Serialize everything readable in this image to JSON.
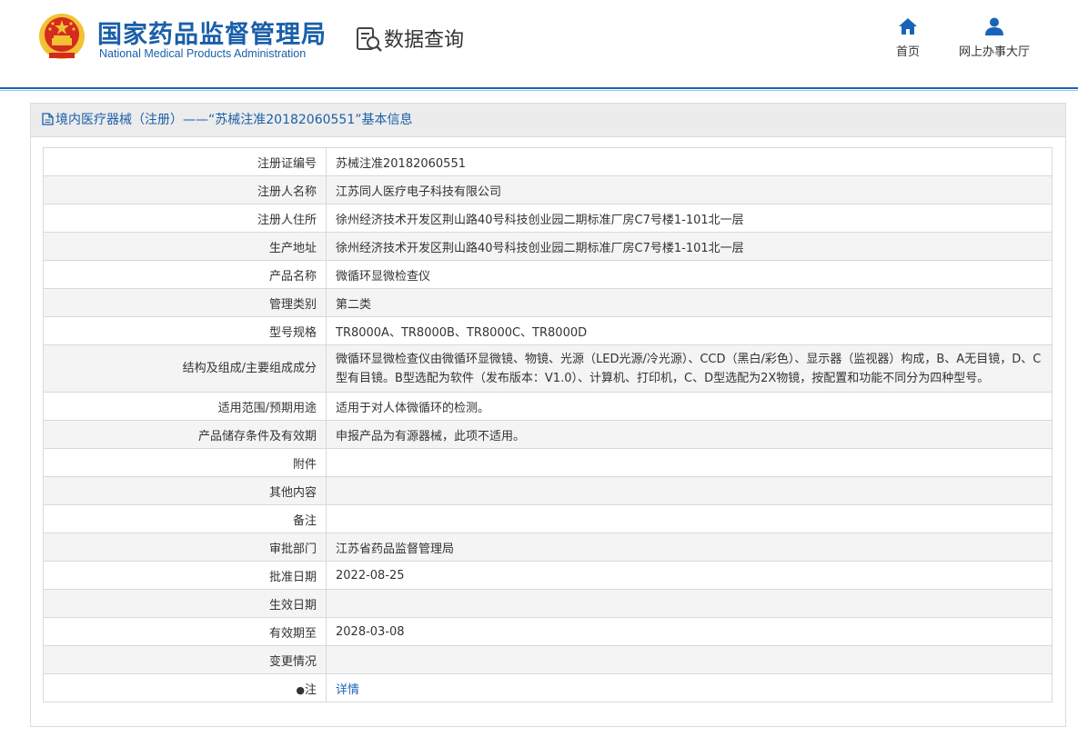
{
  "header": {
    "logo_cn": "国家药品监督管理局",
    "logo_en": "National Medical Products Administration",
    "section_title": "数据查询",
    "nav": [
      {
        "label": "首页",
        "icon": "home-icon"
      },
      {
        "label": "网上办事大厅",
        "icon": "user-icon"
      }
    ]
  },
  "panel": {
    "title": "境内医疗器械（注册）——“苏械注准20182060551”基本信息"
  },
  "colors": {
    "brand_blue": "#1a5fa9",
    "link_blue": "#1a64b8",
    "emblem_red": "#d42a20",
    "emblem_gold": "#f1c232"
  },
  "rows": [
    {
      "label": "注册证编号",
      "value": "苏械注准20182060551"
    },
    {
      "label": "注册人名称",
      "value": "江苏同人医疗电子科技有限公司"
    },
    {
      "label": "注册人住所",
      "value": "徐州经济技术开发区荆山路40号科技创业园二期标准厂房C7号楼1-101北一层"
    },
    {
      "label": "生产地址",
      "value": "徐州经济技术开发区荆山路40号科技创业园二期标准厂房C7号楼1-101北一层"
    },
    {
      "label": "产品名称",
      "value": "微循环显微检查仪"
    },
    {
      "label": "管理类别",
      "value": "第二类"
    },
    {
      "label": "型号规格",
      "value": "TR8000A、TR8000B、TR8000C、TR8000D"
    },
    {
      "label": "结构及组成/主要组成成分",
      "value": "微循环显微检查仪由微循环显微镜、物镜、光源（LED光源/冷光源）、CCD（黑白/彩色）、显示器（监视器）构成，B、A无目镜，D、C型有目镜。B型选配为软件（发布版本：V1.0）、计算机、打印机，C、D型选配为2X物镜，按配置和功能不同分为四种型号。"
    },
    {
      "label": "适用范围/预期用途",
      "value": "适用于对人体微循环的检测。"
    },
    {
      "label": "产品储存条件及有效期",
      "value": "申报产品为有源器械，此项不适用。"
    },
    {
      "label": "附件",
      "value": ""
    },
    {
      "label": "其他内容",
      "value": ""
    },
    {
      "label": "备注",
      "value": ""
    },
    {
      "label": "审批部门",
      "value": "江苏省药品监督管理局"
    },
    {
      "label": "批准日期",
      "value": "2022-08-25"
    },
    {
      "label": "生效日期",
      "value": ""
    },
    {
      "label": "有效期至",
      "value": "2028-03-08"
    },
    {
      "label": "变更情况",
      "value": ""
    }
  ],
  "note_row": {
    "label": "注",
    "icon": "pin-icon",
    "link": "详情"
  }
}
